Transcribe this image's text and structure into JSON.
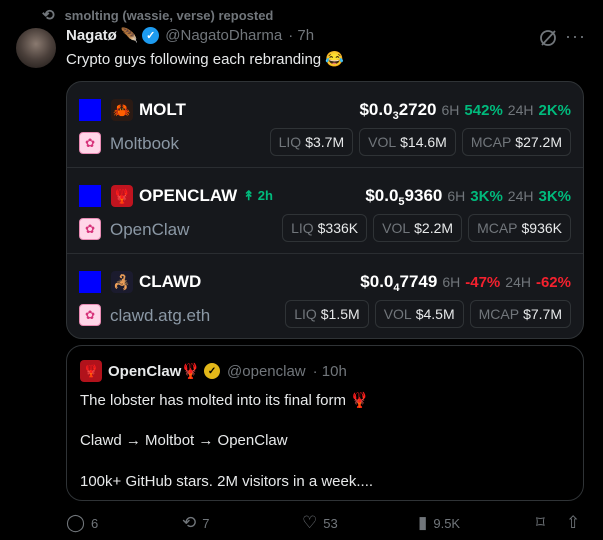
{
  "repost": {
    "label": "smolting (wassie, verse) reposted"
  },
  "author": {
    "name": "Nagatø",
    "handle": "@NagatoDharma",
    "time": "· 7h"
  },
  "tweet": {
    "text": "Crypto guys following each rebranding 😂"
  },
  "tokens": [
    {
      "ticker": "MOLT",
      "age": "",
      "name": "Moltbook",
      "price_prefix": "$0.0",
      "price_zeros": "3",
      "price_digits": "2720",
      "h6_label": "6H",
      "h6": "542%",
      "h6_dir": "up",
      "h24_label": "24H",
      "h24": "2K%",
      "h24_dir": "up",
      "liq_label": "LIQ",
      "liq": "$3.7M",
      "vol_label": "VOL",
      "vol": "$14.6M",
      "mcap_label": "MCAP",
      "mcap": "$27.2M"
    },
    {
      "ticker": "OPENCLAW",
      "age": "2h",
      "name": "OpenClaw",
      "price_prefix": "$0.0",
      "price_zeros": "5",
      "price_digits": "9360",
      "h6_label": "6H",
      "h6": "3K%",
      "h6_dir": "up",
      "h24_label": "24H",
      "h24": "3K%",
      "h24_dir": "up",
      "liq_label": "LIQ",
      "liq": "$336K",
      "vol_label": "VOL",
      "vol": "$2.2M",
      "mcap_label": "MCAP",
      "mcap": "$936K"
    },
    {
      "ticker": "CLAWD",
      "age": "",
      "name": "clawd.atg.eth",
      "price_prefix": "$0.0",
      "price_zeros": "4",
      "price_digits": "7749",
      "h6_label": "6H",
      "h6": "-47%",
      "h6_dir": "down",
      "h24_label": "24H",
      "h24": "-62%",
      "h24_dir": "down",
      "liq_label": "LIQ",
      "liq": "$1.5M",
      "vol_label": "VOL",
      "vol": "$4.5M",
      "mcap_label": "MCAP",
      "mcap": "$7.7M"
    }
  ],
  "quote": {
    "name": "OpenClaw🦞",
    "handle": "@openclaw",
    "time": "· 10h",
    "line1": "The lobster has molted into its final form 🦞",
    "line2": "Clawd → Moltbot → OpenClaw",
    "line3": "100k+ GitHub stars. 2M visitors in a week...."
  },
  "actions": {
    "replies": "6",
    "reposts": "7",
    "likes": "53",
    "views": "9.5K"
  }
}
